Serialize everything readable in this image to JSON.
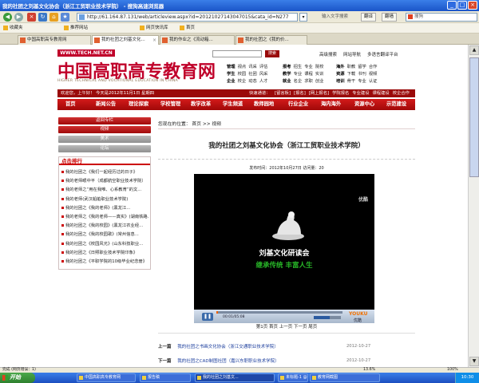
{
  "window": {
    "title": "我的社团之刘基文化协会（浙江工贸职业技术学院） - 搜狗高速浏览器"
  },
  "browser": {
    "url": "http://61.164.87.131/web/articleview.aspx?id=20121027143047015&cata_id=N277",
    "input_hint": "输入文字搜索",
    "toolbar_buttons": [
      "翻译",
      "翻墙"
    ],
    "search_placeholder": "搜狗",
    "favorites": [
      "收藏夹",
      "推荐网站",
      "网页快讯库",
      "首页"
    ],
    "tabs": [
      {
        "label": "中国高职高专教育网",
        "active": false
      },
      {
        "label": "我的社团之刘基文化...",
        "active": true
      },
      {
        "label": "我的作业之《流动箱...",
        "active": false
      },
      {
        "label": "我的社团之《我的价...",
        "active": false
      }
    ]
  },
  "site": {
    "url_badge": "WWW.TECH.NET.CN",
    "logo": "中国高职高专教育网",
    "logo_subtitle": "HIGHER TECHNICAL AND VOCATIONAL EDUCATION IN CHINA",
    "search_button": "搜索",
    "header_links": [
      "高级搜索",
      "网站导航",
      "多语言翻译平台"
    ],
    "categories": [
      {
        "head": "管理",
        "items": [
          "视点",
          "讯采",
          "评估"
        ]
      },
      {
        "head": "学生",
        "items": [
          "校园",
          "社团",
          "风采"
        ]
      },
      {
        "head": "企业",
        "items": [
          "校企",
          "动态",
          "人才"
        ]
      },
      {
        "head": "报考",
        "items": [
          "招生",
          "专业",
          "院校"
        ]
      },
      {
        "head": "教学",
        "items": [
          "专业",
          "课程",
          "实训"
        ]
      },
      {
        "head": "就业",
        "items": [
          "名企",
          "求职",
          "创业"
        ]
      },
      {
        "head": "海外",
        "items": [
          "职教",
          "留学",
          "合作"
        ]
      },
      {
        "head": "资源",
        "items": [
          "下载",
          "书刊",
          "视频"
        ]
      },
      {
        "head": "培训",
        "items": [
          "骨干",
          "专业",
          "认证"
        ]
      }
    ],
    "welcome": "欢迎您，上午好！ 今天是2012年11月1日 星期四",
    "quick_label": "快速通道：",
    "quick_links": [
      "[留言板]",
      "[报名]",
      "[网上报名]",
      "学院报名",
      "专业建设",
      "课程建设",
      "校企合作"
    ],
    "nav": [
      "首页",
      "新闻公告",
      "理论探索",
      "学校管理",
      "教学改革",
      "学生频道",
      "教师园地",
      "行业企业",
      "海内海外",
      "资源中心",
      "示范建设"
    ]
  },
  "sidebar": {
    "buttons": [
      {
        "label": "返回专栏",
        "style": "red"
      },
      {
        "label": "视频",
        "style": "red"
      },
      {
        "label": "美术",
        "style": "gray"
      },
      {
        "label": "论坛",
        "style": "gray"
      }
    ],
    "ranking_title": "点击排行",
    "ranking": [
      "我的社团之《我们一起经历过的日子》",
      "我的老师眼中平（成都航空职业技术学院）",
      "我的老师之“用在我唯、心系教育”的文...",
      "我的老师(武汉船舶职业技术学院)",
      "我的社团之《我的老师》(黑龙江...",
      "我的老师之《我的老师——真实》(湖南铁路...",
      "我的社团之《我的校园》(黑龙江农业经...",
      "我的社团之《我的校园歌》(常州信息...",
      "我的社团之《校园风光》(山东科技职业...",
      "我的社团之《日照职业技术学院印象》",
      "我的社团之《平职学院的10级毕业纪念册》"
    ]
  },
  "article": {
    "breadcrumb": "您现在的位置： 首页 >> 视频",
    "title": "我的社团之刘基文化协会（浙江工贸职业技术学院）",
    "meta": "发布时间：2012年10月27日    访问量：20",
    "video": {
      "watermark": "优酷",
      "caption_line1": "刘基文化研读会",
      "caption_line2": "继承传统 丰富人生",
      "timecode": "00:01/05:08",
      "player_brand": "YOUKU",
      "player_brand_sub": "优酷",
      "progress": 0.01,
      "volume": 0.6
    },
    "pager": "第1页  首页  上一页  下一页  尾页",
    "prev": {
      "label": "上一篇",
      "title": "我的社团之书画文化协会（浙江交通职业技术学院）",
      "date": "2012-10-27"
    },
    "next": {
      "label": "下一篇",
      "title": "我的社团之CAD制图社团（嘉兴东职职业技术学院）",
      "date": "2012-10-27"
    }
  },
  "statusbar": {
    "text": "完成 (网页错误：1)",
    "zoom": "100%",
    "internet": "13.6%"
  },
  "taskbar": {
    "start": "开始",
    "tasks": [
      {
        "label": "中国高职高专教育网",
        "active": false
      },
      {
        "label": "报告稿",
        "active": false
      },
      {
        "label": "我的社团之刘基文...",
        "active": true
      },
      {
        "label": "未标题-1 @ 66.7%...",
        "active": false
      },
      {
        "label": "教育网截图",
        "active": false
      }
    ],
    "clock": "10:30"
  },
  "colors": {
    "brand_red": "#c0002a",
    "nav_red": "#b00a0a",
    "link_blue": "#1a3c9c"
  }
}
